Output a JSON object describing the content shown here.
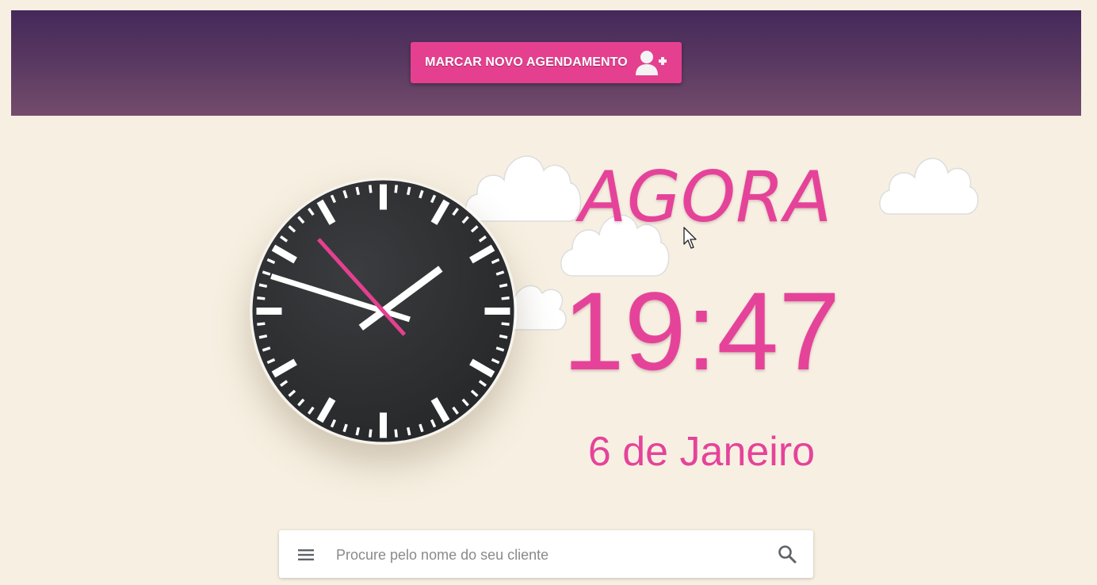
{
  "header": {
    "new_appointment_label": "MARCAR NOVO AGENDAMENTO",
    "new_appointment_icon": "user-plus-icon",
    "gradient_colors": [
      "#45295a",
      "#744c6c"
    ]
  },
  "clock": {
    "hours": 19,
    "minutes": 47,
    "seconds": 53,
    "face_color": "#2f3033",
    "hand_color": "#ffffff",
    "second_hand_color": "#e5408f"
  },
  "display": {
    "now_label": "AGORA",
    "time": "19:47",
    "date": "6 de Janeiro"
  },
  "search": {
    "placeholder": "Procure pelo nome do seu cliente",
    "value": "",
    "menu_icon": "menu-icon",
    "search_icon": "search-icon"
  },
  "colors": {
    "accent": "#e5408f",
    "background": "#f7f0e2",
    "text_accent": "#e5439a"
  }
}
